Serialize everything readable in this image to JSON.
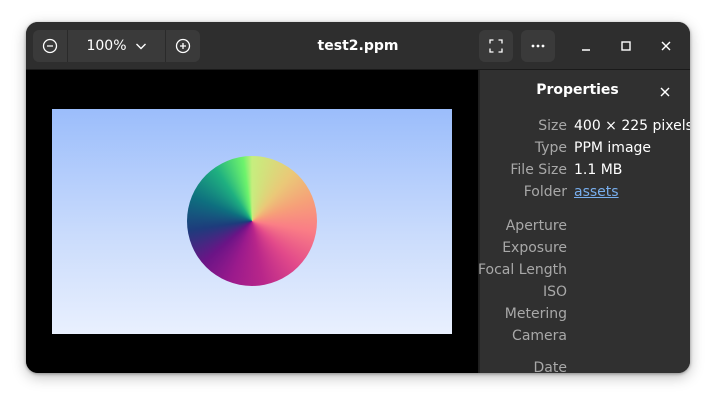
{
  "window": {
    "title": "test2.ppm",
    "zoom": {
      "level": "100%"
    }
  },
  "image": {
    "file_name": "test2.ppm"
  },
  "properties": {
    "heading": "Properties",
    "rows": [
      {
        "label": "Size",
        "value": "400 × 225 pixels"
      },
      {
        "label": "Type",
        "value": "PPM image"
      },
      {
        "label": "File Size",
        "value": "1.1 MB"
      },
      {
        "label": "Folder",
        "value": "assets"
      }
    ],
    "camera_rows": [
      {
        "label": "Aperture",
        "value": ""
      },
      {
        "label": "Exposure",
        "value": ""
      },
      {
        "label": "Focal Length",
        "value": ""
      },
      {
        "label": "ISO",
        "value": ""
      },
      {
        "label": "Metering",
        "value": ""
      },
      {
        "label": "Camera",
        "value": ""
      }
    ],
    "date_label": "Date"
  },
  "icons": {
    "zoom_out": "zoom-out-icon",
    "zoom_in": "zoom-in-icon",
    "fullscreen": "fullscreen-icon",
    "menu": "more-icon",
    "minimize": "minimize-icon",
    "maximize": "maximize-icon",
    "close": "close-icon"
  },
  "colors": {
    "link": "#78aeed",
    "headerbar": "#2e2e2e",
    "sidebar": "#303030"
  }
}
